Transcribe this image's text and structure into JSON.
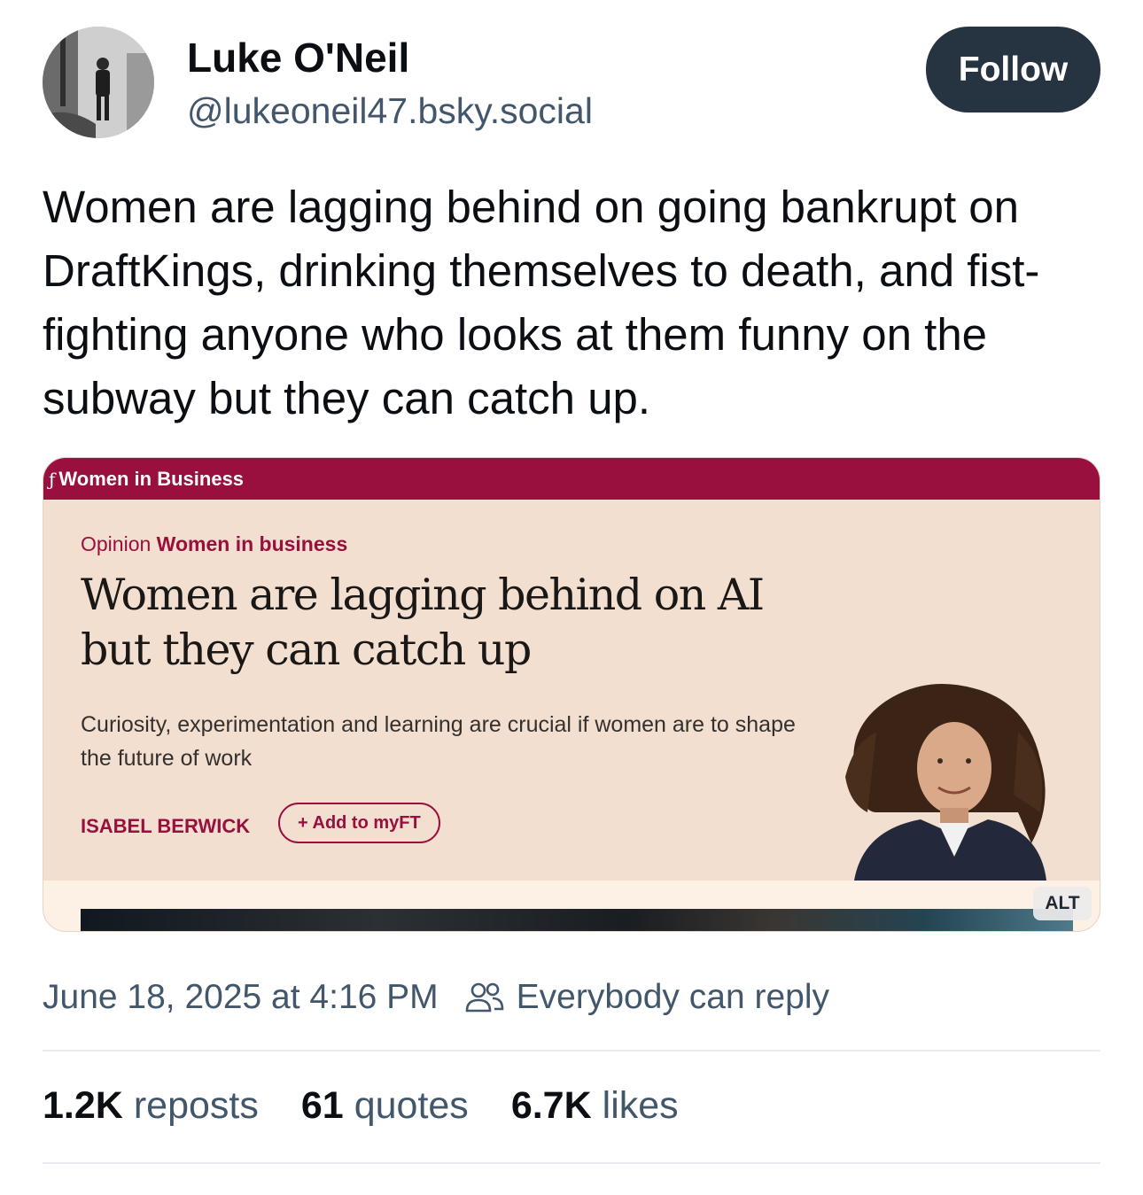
{
  "author": {
    "display_name": "Luke O'Neil",
    "handle": "@lukeoneil47.bsky.social"
  },
  "follow_label": "Follow",
  "post_text": "Women are lagging behind on going bankrupt on DraftKings, drinking themselves to death, and fist-fighting anyone who looks at them funny on the subway but they can catch up.",
  "embed": {
    "section_bar": "Women in Business",
    "eyebrow_type": "Opinion",
    "eyebrow_topic": "Women in business",
    "headline": "Women are lagging behind on AI but they can catch up",
    "standfirst": "Curiosity, experimentation and learning are crucial if women are to shape the future of work",
    "byline": "ISABEL BERWICK",
    "myft_label": "+ Add to myFT",
    "alt_badge": "ALT"
  },
  "meta": {
    "timestamp": "June 18, 2025 at 4:16 PM",
    "reply_setting": "Everybody can reply"
  },
  "stats": {
    "reposts_count": "1.2K",
    "reposts_label": "reposts",
    "quotes_count": "61",
    "quotes_label": "quotes",
    "likes_count": "6.7K",
    "likes_label": "likes"
  },
  "colors": {
    "follow_bg": "#263340",
    "ft_claret": "#990f3d",
    "ft_paper": "#f2dfd0",
    "muted_text": "#42576c"
  }
}
